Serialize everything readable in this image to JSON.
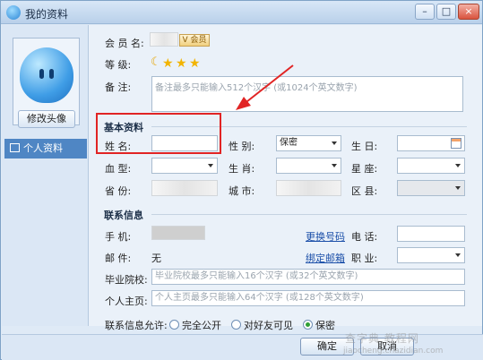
{
  "window": {
    "title": "我的资料",
    "min": "–",
    "max": "□",
    "close": "×"
  },
  "sidebar": {
    "avatar_button": "修改头像",
    "nav_item": "个人资料"
  },
  "profile": {
    "member_label": "会 员 名:",
    "vip_badge": "V 会员",
    "level_label": "等    级:",
    "level_icons": [
      "moon",
      "star",
      "star",
      "star"
    ],
    "note_label": "备    注:",
    "note_placeholder": "备注最多只能输入512个汉字 (或1024个英文数字)"
  },
  "basic": {
    "section_title": "基本资料",
    "name_label": "姓    名:",
    "name_value": "",
    "gender_label": "性    别:",
    "gender_value": "保密",
    "birthday_label": "生    日:",
    "blood_label": "血    型:",
    "zodiac_label": "生    肖:",
    "star_label": "星    座:",
    "province_label": "省    份:",
    "city_label": "城    市:",
    "district_label": "区    县:"
  },
  "contact": {
    "section_title": "联系信息",
    "mobile_label": "手    机:",
    "change_number": "更换号码",
    "phone_label": "电    话:",
    "email_label": "邮    件:",
    "email_value": "无",
    "bind_email": "绑定邮箱",
    "job_label": "职    业:",
    "school_label": "毕业院校:",
    "school_placeholder": "毕业院校最多只能输入16个汉字 (或32个英文数字)",
    "homepage_label": "个人主页:",
    "homepage_placeholder": "个人主页最多只能输入64个汉字 (或128个英文数字)",
    "visibility_label": "联系信息允许:",
    "options": [
      "完全公开",
      "对好友可见",
      "保密"
    ],
    "selected_option": "保密"
  },
  "footer": {
    "ok": "确定",
    "cancel": "取消"
  },
  "watermark": {
    "text": "查字典 教程网",
    "sub": "jiaocheng.chazidian.com"
  },
  "annotation": {
    "highlight_color": "#e12424"
  }
}
